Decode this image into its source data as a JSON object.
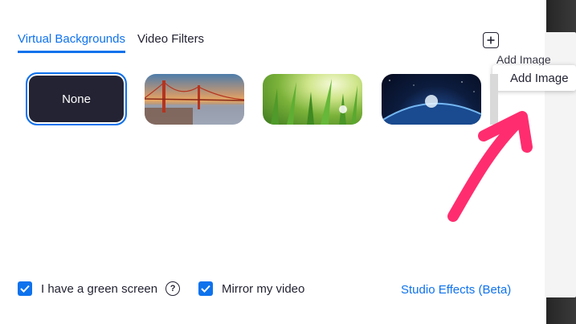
{
  "tabs": [
    {
      "label": "Virtual Backgrounds",
      "active": true
    },
    {
      "label": "Video Filters",
      "active": false
    }
  ],
  "add_image": {
    "icon": "plus-square-icon",
    "tooltip_label": "Add Image",
    "tooltip_shadow_label": "Add Image"
  },
  "backgrounds": [
    {
      "label": "None",
      "selected": true
    },
    {
      "label": "",
      "image": "golden-gate-bridge"
    },
    {
      "label": "",
      "image": "grass"
    },
    {
      "label": "",
      "image": "earth-from-space"
    }
  ],
  "options": {
    "green_screen_label": "I have a green screen",
    "green_screen_checked": true,
    "mirror_label": "Mirror my video",
    "mirror_checked": true,
    "help_icon": "question-circle-icon",
    "studio_effects_label": "Studio Effects (Beta)"
  },
  "colors": {
    "accent": "#0e72ed",
    "text": "#232333",
    "annotation_arrow": "#ff2d6f"
  }
}
